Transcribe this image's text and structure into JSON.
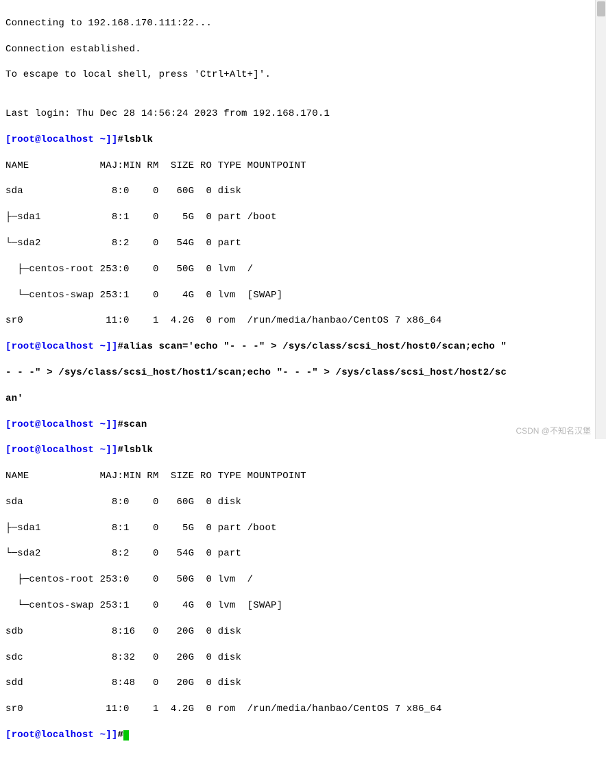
{
  "intro": {
    "connecting": "Connecting to 192.168.170.111:22...",
    "established": "Connection established.",
    "escape": "To escape to local shell, press 'Ctrl+Alt+]'.",
    "blank": "",
    "lastlogin": "Last login: Thu Dec 28 14:56:24 2023 from 192.168.170.1"
  },
  "prompt": {
    "text": "[root@localhost ~]]",
    "hash": "#"
  },
  "cmd": {
    "lsblk": "lsblk",
    "alias1": "alias scan='echo \"- - -\" > /sys/class/scsi_host/host0/scan;echo \"",
    "alias2": "- - -\" > /sys/class/scsi_host/host1/scan;echo \"- - -\" > /sys/class/scsi_host/host2/sc",
    "alias3": "an'",
    "scan": "scan"
  },
  "lsblk1": {
    "header": "NAME            MAJ:MIN RM  SIZE RO TYPE MOUNTPOINT",
    "r1": "sda               8:0    0   60G  0 disk ",
    "r2": "├─sda1            8:1    0    5G  0 part /boot",
    "r3": "└─sda2            8:2    0   54G  0 part ",
    "r4": "  ├─centos-root 253:0    0   50G  0 lvm  /",
    "r5": "  └─centos-swap 253:1    0    4G  0 lvm  [SWAP]",
    "r6": "sr0              11:0    1  4.2G  0 rom  /run/media/hanbao/CentOS 7 x86_64"
  },
  "lsblk2": {
    "header": "NAME            MAJ:MIN RM  SIZE RO TYPE MOUNTPOINT",
    "r1": "sda               8:0    0   60G  0 disk ",
    "r2": "├─sda1            8:1    0    5G  0 part /boot",
    "r3": "└─sda2            8:2    0   54G  0 part ",
    "r4": "  ├─centos-root 253:0    0   50G  0 lvm  /",
    "r5": "  └─centos-swap 253:1    0    4G  0 lvm  [SWAP]",
    "r6": "sdb               8:16   0   20G  0 disk ",
    "r7": "sdc               8:32   0   20G  0 disk ",
    "r8": "sdd               8:48   0   20G  0 disk ",
    "r9": "sr0              11:0    1  4.2G  0 rom  /run/media/hanbao/CentOS 7 x86_64"
  },
  "watermark": "CSDN @不知名汉堡"
}
